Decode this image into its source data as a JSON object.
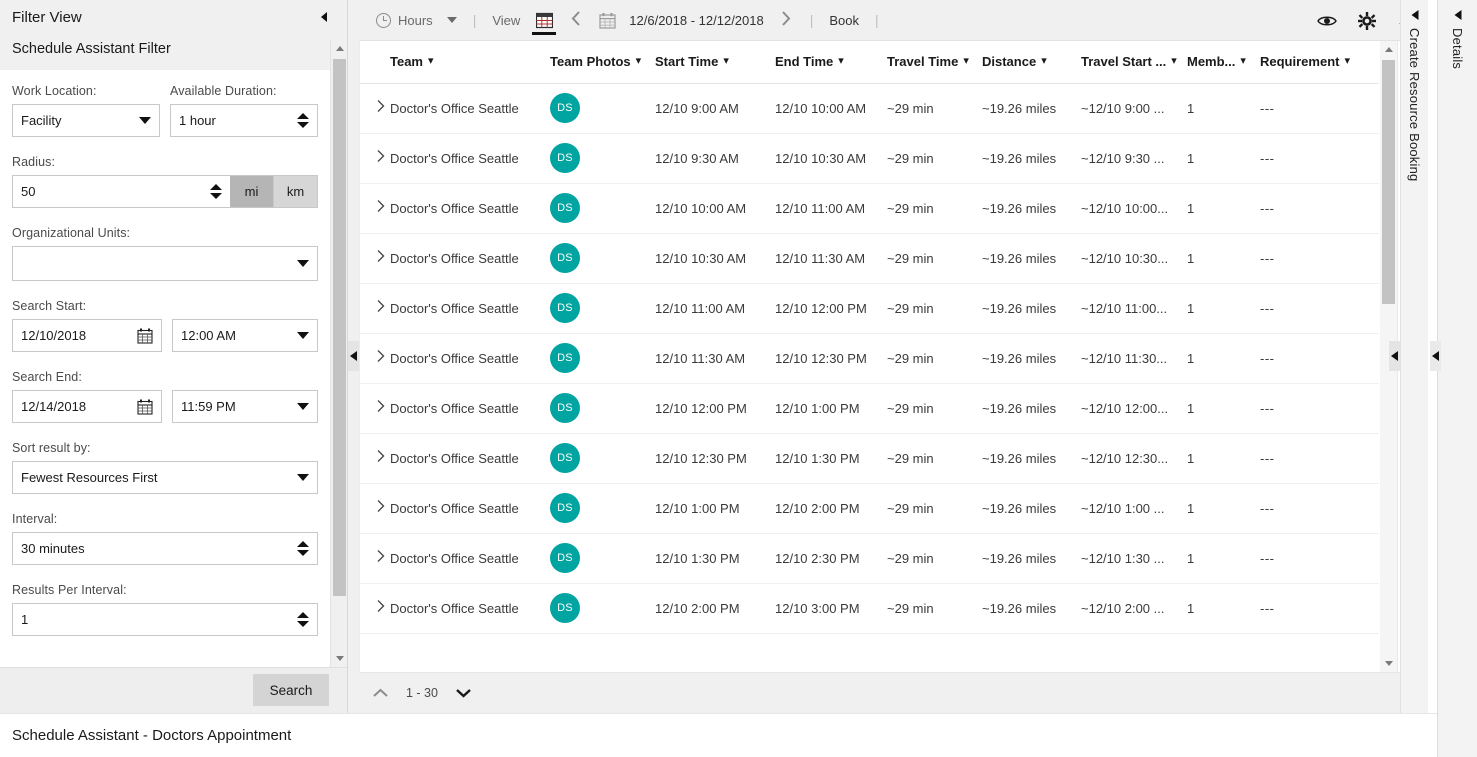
{
  "filter_panel": {
    "title": "Filter View",
    "subtitle": "Schedule Assistant Filter",
    "collapse_icon": "collapse-left-icon",
    "fields": {
      "work_location": {
        "label": "Work Location:",
        "value": "Facility"
      },
      "available_duration": {
        "label": "Available Duration:",
        "value": "1 hour"
      },
      "radius": {
        "label": "Radius:",
        "value": "50",
        "unit_mi": "mi",
        "unit_km": "km",
        "selected_unit": "mi"
      },
      "organizational_units": {
        "label": "Organizational Units:",
        "value": ""
      },
      "search_start": {
        "label": "Search Start:",
        "date": "12/10/2018",
        "time": "12:00 AM"
      },
      "search_end": {
        "label": "Search End:",
        "date": "12/14/2018",
        "time": "11:59 PM"
      },
      "sort_result_by": {
        "label": "Sort result by:",
        "value": "Fewest Resources First"
      },
      "interval": {
        "label": "Interval:",
        "value": "30 minutes"
      },
      "results_per_interval": {
        "label": "Results Per Interval:",
        "value": "1"
      }
    },
    "search_button": "Search"
  },
  "toolbar": {
    "hours_label": "Hours",
    "hours_icon": "clock-icon",
    "separator": "|",
    "view_label": "View",
    "grid_icon": "grid-view-icon",
    "prev_icon": "chevron-left-icon",
    "calendar_icon": "calendar-icon",
    "date_range": "12/6/2018 - 12/12/2018",
    "next_icon": "chevron-right-icon",
    "book_label": "Book",
    "right_icons": [
      "eye-icon",
      "gear-icon",
      "refresh-icon"
    ]
  },
  "grid": {
    "columns": [
      {
        "key": "team",
        "label": "Team"
      },
      {
        "key": "team_photos",
        "label": "Team Photos"
      },
      {
        "key": "start_time",
        "label": "Start Time"
      },
      {
        "key": "end_time",
        "label": "End Time"
      },
      {
        "key": "travel_time",
        "label": "Travel Time"
      },
      {
        "key": "distance",
        "label": "Distance"
      },
      {
        "key": "travel_start",
        "label": "Travel Start ..."
      },
      {
        "key": "members",
        "label": "Memb..."
      },
      {
        "key": "requirement",
        "label": "Requirement"
      }
    ],
    "rows": [
      {
        "team": "Doctor's Office Seattle",
        "avatar": "DS",
        "start_time": "12/10 9:00 AM",
        "end_time": "12/10 10:00 AM",
        "travel_time": "~29 min",
        "distance": "~19.26 miles",
        "travel_start": "~12/10 9:00 ...",
        "members": "1",
        "requirement": "---"
      },
      {
        "team": "Doctor's Office Seattle",
        "avatar": "DS",
        "start_time": "12/10 9:30 AM",
        "end_time": "12/10 10:30 AM",
        "travel_time": "~29 min",
        "distance": "~19.26 miles",
        "travel_start": "~12/10 9:30 ...",
        "members": "1",
        "requirement": "---"
      },
      {
        "team": "Doctor's Office Seattle",
        "avatar": "DS",
        "start_time": "12/10 10:00 AM",
        "end_time": "12/10 11:00 AM",
        "travel_time": "~29 min",
        "distance": "~19.26 miles",
        "travel_start": "~12/10 10:00...",
        "members": "1",
        "requirement": "---"
      },
      {
        "team": "Doctor's Office Seattle",
        "avatar": "DS",
        "start_time": "12/10 10:30 AM",
        "end_time": "12/10 11:30 AM",
        "travel_time": "~29 min",
        "distance": "~19.26 miles",
        "travel_start": "~12/10 10:30...",
        "members": "1",
        "requirement": "---"
      },
      {
        "team": "Doctor's Office Seattle",
        "avatar": "DS",
        "start_time": "12/10 11:00 AM",
        "end_time": "12/10 12:00 PM",
        "travel_time": "~29 min",
        "distance": "~19.26 miles",
        "travel_start": "~12/10 11:00...",
        "members": "1",
        "requirement": "---"
      },
      {
        "team": "Doctor's Office Seattle",
        "avatar": "DS",
        "start_time": "12/10 11:30 AM",
        "end_time": "12/10 12:30 PM",
        "travel_time": "~29 min",
        "distance": "~19.26 miles",
        "travel_start": "~12/10 11:30...",
        "members": "1",
        "requirement": "---"
      },
      {
        "team": "Doctor's Office Seattle",
        "avatar": "DS",
        "start_time": "12/10 12:00 PM",
        "end_time": "12/10 1:00 PM",
        "travel_time": "~29 min",
        "distance": "~19.26 miles",
        "travel_start": "~12/10 12:00...",
        "members": "1",
        "requirement": "---"
      },
      {
        "team": "Doctor's Office Seattle",
        "avatar": "DS",
        "start_time": "12/10 12:30 PM",
        "end_time": "12/10 1:30 PM",
        "travel_time": "~29 min",
        "distance": "~19.26 miles",
        "travel_start": "~12/10 12:30...",
        "members": "1",
        "requirement": "---"
      },
      {
        "team": "Doctor's Office Seattle",
        "avatar": "DS",
        "start_time": "12/10 1:00 PM",
        "end_time": "12/10 2:00 PM",
        "travel_time": "~29 min",
        "distance": "~19.26 miles",
        "travel_start": "~12/10 1:00 ...",
        "members": "1",
        "requirement": "---"
      },
      {
        "team": "Doctor's Office Seattle",
        "avatar": "DS",
        "start_time": "12/10 1:30 PM",
        "end_time": "12/10 2:30 PM",
        "travel_time": "~29 min",
        "distance": "~19.26 miles",
        "travel_start": "~12/10 1:30 ...",
        "members": "1",
        "requirement": "---"
      },
      {
        "team": "Doctor's Office Seattle",
        "avatar": "DS",
        "start_time": "12/10 2:00 PM",
        "end_time": "12/10 3:00 PM",
        "travel_time": "~29 min",
        "distance": "~19.26 miles",
        "travel_start": "~12/10 2:00 ...",
        "members": "1",
        "requirement": "---"
      }
    ]
  },
  "pager": {
    "prev_icon": "chevron-up-icon",
    "range": "1 - 30",
    "next_icon": "chevron-down-icon"
  },
  "rails": {
    "create_resource_booking": "Create Resource Booking",
    "details": "Details"
  },
  "statusbar": {
    "text": "Schedule Assistant - Doctors Appointment"
  },
  "colors": {
    "accent_teal": "#00a4a0",
    "panel_bg": "#f0f0f0",
    "unit_active": "#b5b5b5"
  }
}
